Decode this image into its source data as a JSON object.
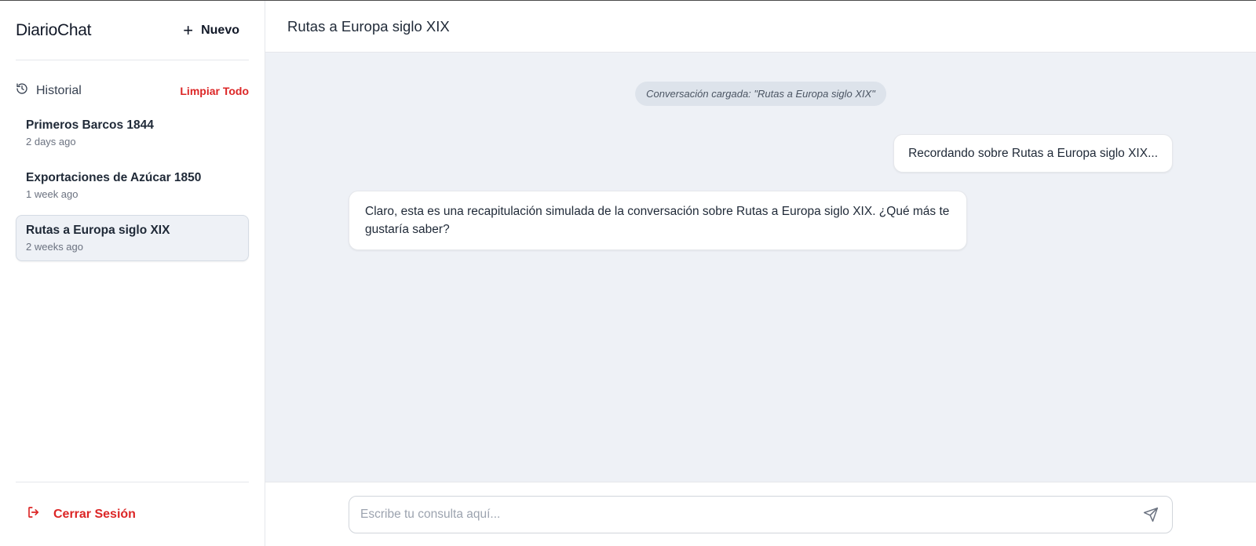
{
  "sidebar": {
    "brand": "DiarioChat",
    "new_button": "Nuevo",
    "history_label": "Historial",
    "clear_all": "Limpiar Todo",
    "conversations": [
      {
        "title": "Primeros Barcos 1844",
        "time": "2 days ago"
      },
      {
        "title": "Exportaciones de Azúcar 1850",
        "time": "1 week ago"
      },
      {
        "title": "Rutas a Europa siglo XIX",
        "time": "2 weeks ago"
      }
    ],
    "active_index": 2,
    "logout": "Cerrar Sesión"
  },
  "main": {
    "title": "Rutas a Europa siglo XIX",
    "system_message": "Conversación cargada: \"Rutas a Europa siglo XIX\"",
    "messages": [
      {
        "role": "user",
        "text": "Recordando sobre Rutas a Europa siglo XIX..."
      },
      {
        "role": "assistant",
        "text": "Claro, esta es una recapitulación simulada de la conversación sobre Rutas a Europa siglo XIX. ¿Qué más te gustaría saber?"
      }
    ],
    "composer": {
      "placeholder": "Escribe tu consulta aquí...",
      "value": ""
    }
  },
  "colors": {
    "accent_red": "#dc2626",
    "chat_bg": "#eef1f6",
    "active_item_bg": "#eef1f6"
  },
  "icons": {
    "new": "plus-icon",
    "history": "history-icon",
    "logout": "logout-icon",
    "send": "send-icon"
  }
}
